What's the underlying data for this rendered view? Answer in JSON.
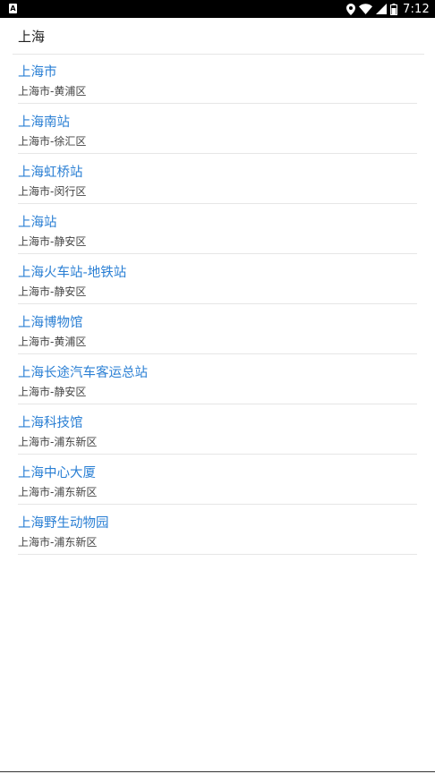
{
  "statusbar": {
    "left_icon_letter": "A",
    "time": "7:12",
    "icons": [
      "location-icon",
      "wifi-icon",
      "signal-icon",
      "battery-icon"
    ]
  },
  "search": {
    "value": "上海"
  },
  "results": [
    {
      "title": "上海市",
      "subtitle": "上海市-黄浦区"
    },
    {
      "title": "上海南站",
      "subtitle": "上海市-徐汇区"
    },
    {
      "title": "上海虹桥站",
      "subtitle": "上海市-闵行区"
    },
    {
      "title": "上海站",
      "subtitle": "上海市-静安区"
    },
    {
      "title": "上海火车站-地铁站",
      "subtitle": "上海市-静安区"
    },
    {
      "title": "上海博物馆",
      "subtitle": "上海市-黄浦区"
    },
    {
      "title": "上海长途汽车客运总站",
      "subtitle": "上海市-静安区"
    },
    {
      "title": "上海科技馆",
      "subtitle": "上海市-浦东新区"
    },
    {
      "title": "上海中心大厦",
      "subtitle": "上海市-浦东新区"
    },
    {
      "title": "上海野生动物园",
      "subtitle": "上海市-浦东新区"
    }
  ],
  "colors": {
    "title_blue": "#2a7fd4",
    "subtitle": "#444444",
    "divider": "#e6e6e6"
  }
}
